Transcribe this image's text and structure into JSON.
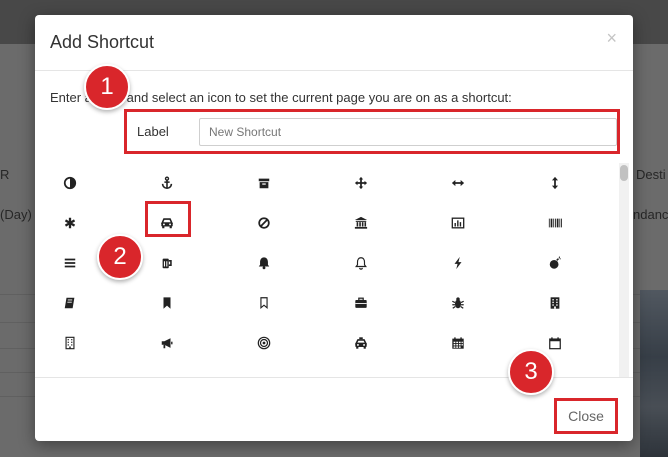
{
  "background": {
    "fragments": [
      "R",
      "(Day)",
      "Desti",
      "ndanc"
    ]
  },
  "modal": {
    "title": "Add Shortcut",
    "close_x": "×",
    "intro": "Enter a label and select an icon to set the current page you are on as a shortcut:",
    "label_text": "Label",
    "input_value": "",
    "input_placeholder": "New Shortcut",
    "close_button": "Close",
    "selected_icon": "car"
  },
  "icons": [
    [
      "adjust",
      "anchor",
      "archive",
      "arrows",
      "arrows-h",
      "arrows-v"
    ],
    [
      "asterisk",
      "car",
      "ban",
      "bank",
      "bar-chart",
      "barcode"
    ],
    [
      "bars",
      "beer",
      "bell",
      "bell-outline",
      "bolt",
      "bomb"
    ],
    [
      "book",
      "bookmark",
      "bookmark-outline",
      "briefcase",
      "bug",
      "building"
    ],
    [
      "building-outline",
      "bullhorn",
      "bullseye",
      "cab",
      "calendar",
      "calendar-outline"
    ]
  ],
  "steps": [
    "1",
    "2",
    "3"
  ],
  "colors": {
    "highlight": "#d9262b",
    "icon": "#222222"
  }
}
